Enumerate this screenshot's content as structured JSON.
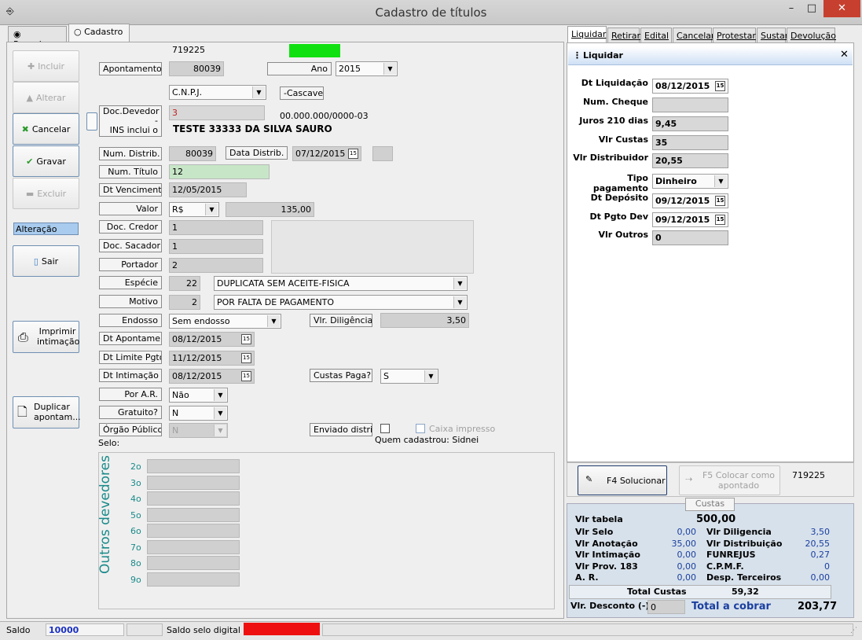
{
  "window": {
    "title": "Cadastro de títulos",
    "min": "–",
    "max": "□",
    "close": "✕"
  },
  "tabs": [
    {
      "label": "Pesquisa"
    },
    {
      "label": "Cadastro"
    }
  ],
  "right_tabs": [
    "Liquidar",
    "Retirar",
    "Edital",
    "Cancelar",
    "Protestar",
    "Sustar",
    "Devolução"
  ],
  "sidebar": {
    "incluir": "Incluir",
    "alterar": "Alterar",
    "cancelar": "Cancelar",
    "gravar": "Gravar",
    "excluir": "Excluir",
    "status": "Alteração",
    "sair": "Sair",
    "imprimir": "Imprimir\nintimação",
    "duplicar": "Duplicar\napontam..."
  },
  "form": {
    "protocol": "719225",
    "apontamento_label": "Apontamento",
    "apontamento": "80039",
    "ano_label": "Ano",
    "ano": "2015",
    "doc_type": "C.N.P.J.",
    "cascavel": "-Cascavel-",
    "doc_devedor_label": "Doc.Devedor -\nINS inclui o\nmesmo docto.",
    "doc_devedor": "3",
    "doc_formatted": "00.000.000/0000-03",
    "devedor_nome": "TESTE 33333 DA SILVA SAURO",
    "num_distrib_label": "Num. Distrib.",
    "num_distrib": "80039",
    "data_distrib_label": "Data Distrib.",
    "data_distrib": "07/12/2015",
    "num_titulo_label": "Num. Título",
    "num_titulo": "12",
    "dt_venc_label": "Dt Vencimento",
    "dt_venc": "12/05/2015",
    "valor_label": "Valor",
    "moeda": "R$",
    "valor": "135,00",
    "doc_credor_label": "Doc. Credor",
    "doc_credor": "1",
    "doc_sacador_label": "Doc. Sacador",
    "doc_sacador": "1",
    "portador_label": "Portador",
    "portador": "2",
    "especie_label": "Espécie",
    "especie_cod": "22",
    "especie": "DUPLICATA SEM ACEITE-FISICA",
    "motivo_label": "Motivo",
    "motivo_cod": "2",
    "motivo": "POR FALTA DE PAGAMENTO",
    "endosso_label": "Endosso",
    "endosso": "Sem endosso",
    "diligencia_label": "Vlr. Diligência",
    "diligencia": "3,50",
    "dt_apont_label": "Dt Apontamento",
    "dt_apont": "08/12/2015",
    "dt_limite_label": "Dt Limite Pgto",
    "dt_limite": "11/12/2015",
    "dt_intim_label": "Dt Intimação",
    "dt_intim": "08/12/2015",
    "custas_paga_label": "Custas Paga?",
    "custas_paga": "S",
    "por_ar_label": "Por A.R.",
    "por_ar": "Não",
    "gratuito_label": "Gratuito?",
    "gratuito": "N",
    "orgao_label": "Órgão Público",
    "orgao": "N",
    "enviado_label": "Enviado distrib.",
    "caixa_label": "Caixa impresso",
    "quem_cadastrou": "Quem cadastrou: Sidnei",
    "selo_label": "Selo:",
    "outros_label": "Outros devedores",
    "outros_rows": [
      "2o",
      "3o",
      "4o",
      "5o",
      "6o",
      "7o",
      "8o",
      "9o"
    ]
  },
  "liquidar": {
    "header": "Liquidar",
    "rows": [
      {
        "label": "Dt Liquidação",
        "value": "08/12/2015",
        "cal": true
      },
      {
        "label": "Num. Cheque",
        "value": ""
      },
      {
        "label": "Juros 210 dias",
        "value": "9,45"
      },
      {
        "label": "Vlr Custas",
        "value": "35"
      },
      {
        "label": "Vlr Distribuidor",
        "value": "20,55"
      },
      {
        "label": "Tipo pagamento",
        "value": "Dinheiro",
        "dd": true
      },
      {
        "label": "Dt Depósito",
        "value": "09/12/2015",
        "cal": true
      },
      {
        "label": "Dt Pgto Dev",
        "value": "09/12/2015",
        "cal": true
      },
      {
        "label": "Vlr Outros",
        "value": "0"
      }
    ],
    "solucionar": "F4 Solucionar",
    "colocar": "F5  Colocar como\napontado",
    "protocol": "719225"
  },
  "custas": {
    "title": "Custas",
    "tabela_label": "Vlr tabela",
    "tabela": "500,00",
    "left": [
      [
        "Vlr Selo",
        "0,00"
      ],
      [
        "Vlr Anotação",
        "35,00"
      ],
      [
        "Vlr Intimação",
        "0,00"
      ],
      [
        "Vlr Prov. 183",
        "0,00"
      ],
      [
        "A. R.",
        "0,00"
      ]
    ],
    "right": [
      [
        "Vlr Diligencia",
        "3,50"
      ],
      [
        "Vlr Distribuição",
        "20,55"
      ],
      [
        "FUNREJUS",
        "0,27"
      ],
      [
        "C.P.M.F.",
        "0"
      ],
      [
        "Desp. Terceiros",
        "0,00"
      ]
    ],
    "total_label": "Total Custas",
    "total": "59,32",
    "desconto_label": "Vlr. Desconto (-)",
    "desconto": "0",
    "cobrar_label": "Total a cobrar",
    "cobrar": "203,77"
  },
  "statusbar": {
    "saldo_label": "Saldo",
    "saldo": "10000",
    "selo_label": "Saldo selo digital"
  }
}
